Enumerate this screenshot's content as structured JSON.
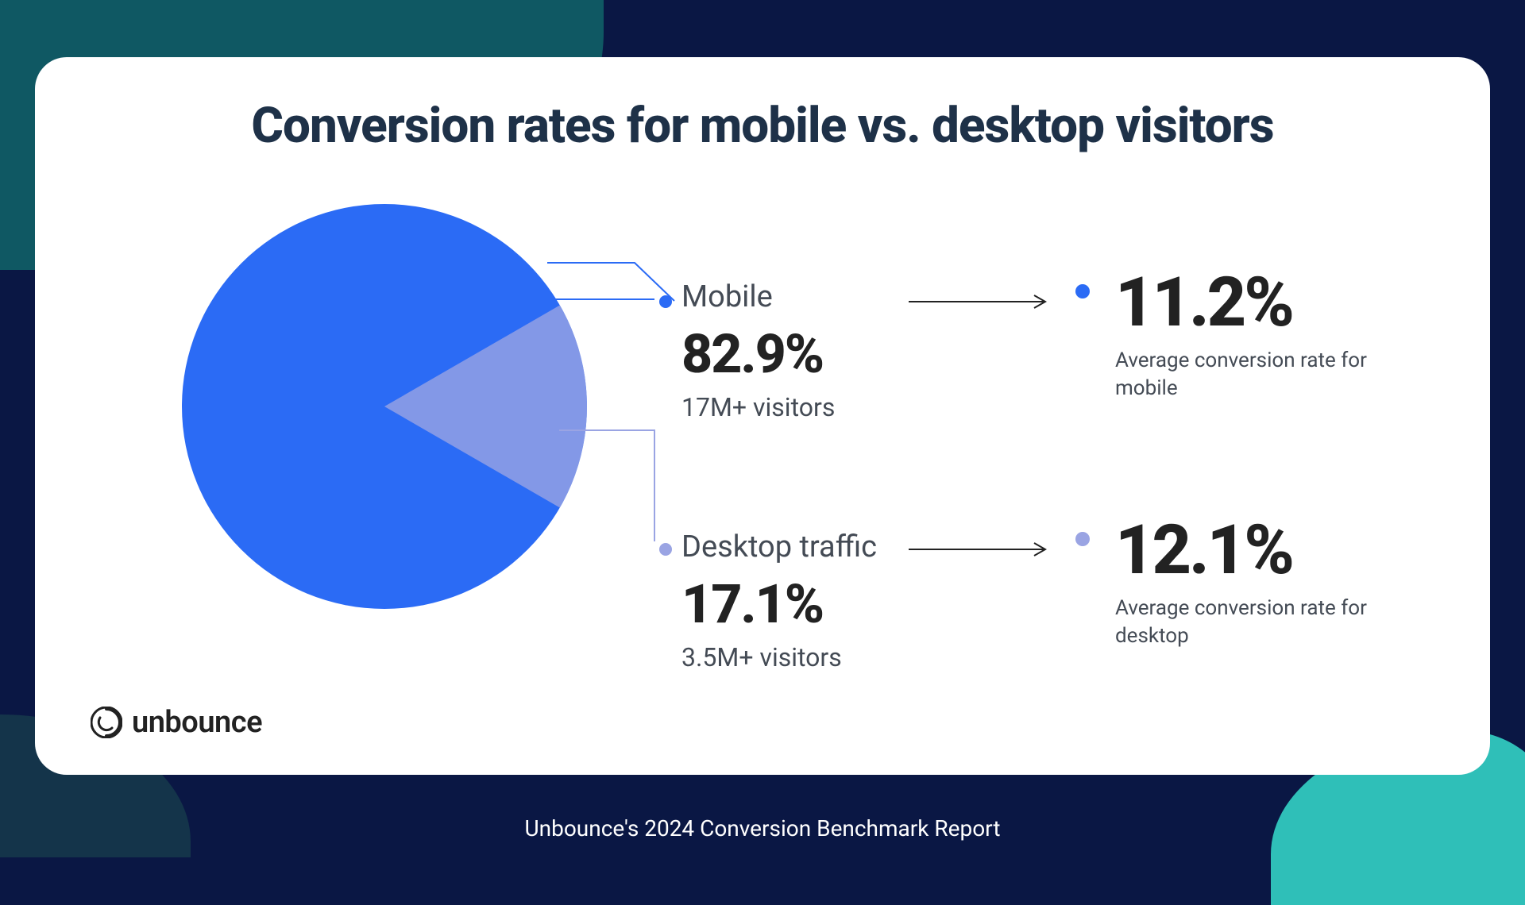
{
  "title": "Conversion rates for mobile vs. desktop visitors",
  "chart_data": {
    "type": "pie",
    "title": "Conversion rates for mobile vs. desktop visitors",
    "series": [
      {
        "name": "Mobile",
        "value": 82.9,
        "visitors": "17M+ visitors",
        "color": "#2b6bf5",
        "conversion_rate": 11.2
      },
      {
        "name": "Desktop traffic",
        "value": 17.1,
        "visitors": "3.5M+ visitors",
        "color": "#9aa4e3",
        "conversion_rate": 12.1
      }
    ]
  },
  "mobile": {
    "label": "Mobile",
    "share": "82.9%",
    "visitors": "17M+ visitors",
    "conversion": "11.2%",
    "conversion_sub": "Average conversion rate for mobile"
  },
  "desktop": {
    "label": "Desktop traffic",
    "share": "17.1%",
    "visitors": "3.5M+ visitors",
    "conversion": "12.1%",
    "conversion_sub": "Average conversion rate for desktop"
  },
  "brand": "unbounce",
  "footer": "Unbounce's 2024 Conversion Benchmark Report"
}
